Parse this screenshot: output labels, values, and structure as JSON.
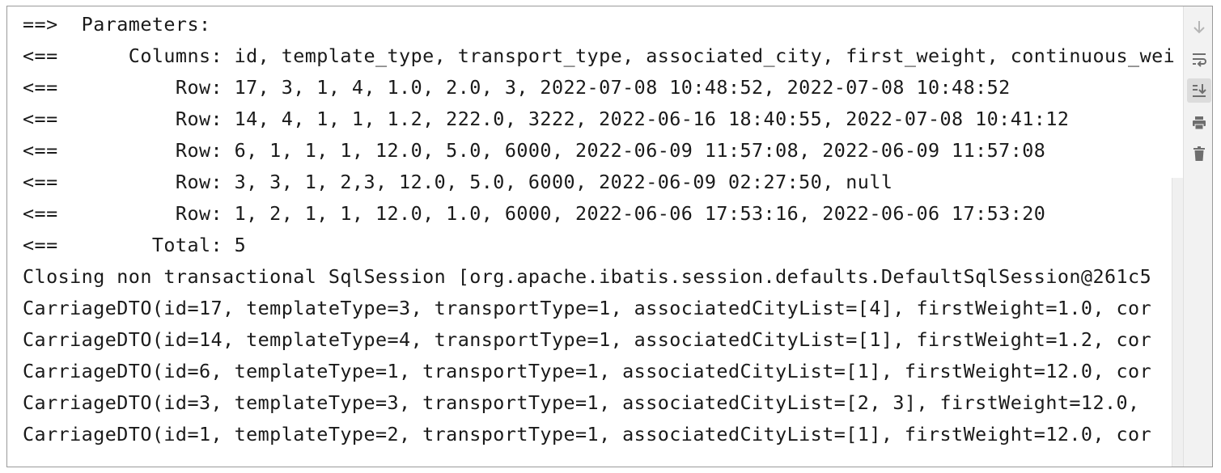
{
  "console": {
    "lines": [
      "==>  Parameters: ",
      "<==      Columns: id, template_type, transport_type, associated_city, first_weight, continuous_wei",
      "<==          Row: 17, 3, 1, 4, 1.0, 2.0, 3, 2022-07-08 10:48:52, 2022-07-08 10:48:52",
      "<==          Row: 14, 4, 1, 1, 1.2, 222.0, 3222, 2022-06-16 18:40:55, 2022-07-08 10:41:12",
      "<==          Row: 6, 1, 1, 1, 12.0, 5.0, 6000, 2022-06-09 11:57:08, 2022-06-09 11:57:08",
      "<==          Row: 3, 3, 1, 2,3, 12.0, 5.0, 6000, 2022-06-09 02:27:50, null",
      "<==          Row: 1, 2, 1, 1, 12.0, 1.0, 6000, 2022-06-06 17:53:16, 2022-06-06 17:53:20",
      "<==        Total: 5",
      "Closing non transactional SqlSession [org.apache.ibatis.session.defaults.DefaultSqlSession@261c5",
      "CarriageDTO(id=17, templateType=3, transportType=1, associatedCityList=[4], firstWeight=1.0, cor",
      "CarriageDTO(id=14, templateType=4, transportType=1, associatedCityList=[1], firstWeight=1.2, cor",
      "CarriageDTO(id=6, templateType=1, transportType=1, associatedCityList=[1], firstWeight=12.0, cor",
      "CarriageDTO(id=3, templateType=3, transportType=1, associatedCityList=[2, 3], firstWeight=12.0, ",
      "CarriageDTO(id=1, templateType=2, transportType=1, associatedCityList=[1], firstWeight=12.0, cor"
    ]
  },
  "toolbar": {
    "buttons": [
      {
        "icon": "arrow-down-icon",
        "name": "scroll-down-button",
        "active": false
      },
      {
        "icon": "soft-wrap-icon",
        "name": "soft-wrap-button",
        "active": false
      },
      {
        "icon": "scroll-to-end-icon",
        "name": "scroll-to-end-button",
        "active": true
      },
      {
        "icon": "printer-icon",
        "name": "print-button",
        "active": false
      },
      {
        "icon": "trash-icon",
        "name": "clear-all-button",
        "active": false
      }
    ]
  },
  "colors": {
    "text": "#1a1a1a",
    "toolbar_bg": "#f2f2f2",
    "icon": "#6e6e6e",
    "icon_disabled": "#b5b5b5"
  }
}
